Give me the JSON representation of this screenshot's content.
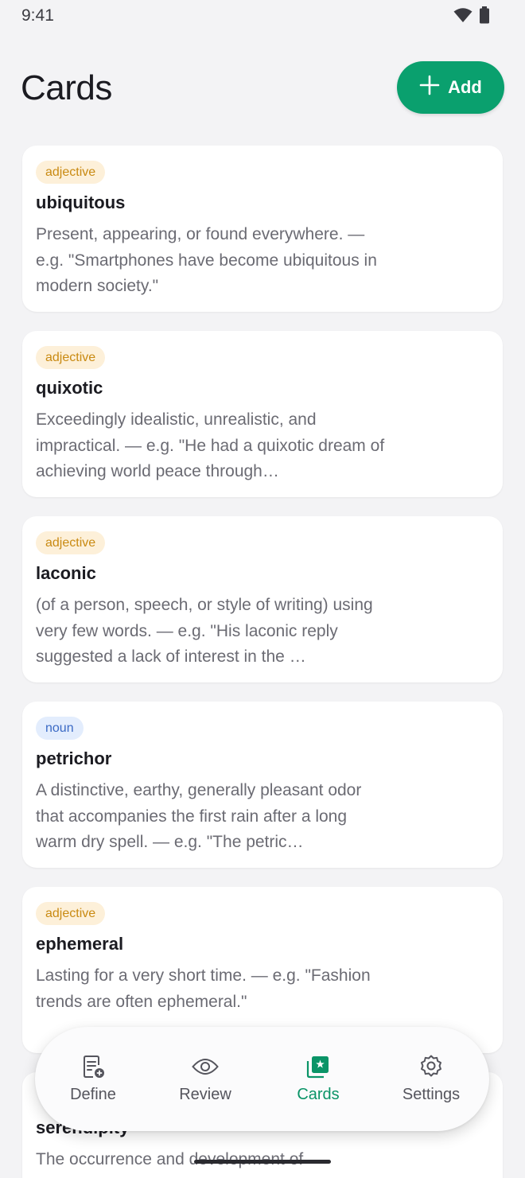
{
  "status_bar": {
    "time": "9:41",
    "icons": [
      "wifi-icon",
      "battery-icon"
    ]
  },
  "header": {
    "title": "Cards",
    "add_label": "Add"
  },
  "cards": [
    {
      "tag": "adjective",
      "word": "ubiquitous",
      "definition": "Present, appearing, or found everywhere. — e.g. \"Smartphones have become ubiquitous in modern society.\""
    },
    {
      "tag": "adjective",
      "word": "quixotic",
      "definition": "Exceedingly idealistic, unrealistic, and impractical. — e.g. \"He had a quixotic dream of achieving world peace through…"
    },
    {
      "tag": "adjective",
      "word": "laconic",
      "definition": "(of a person, speech, or style of writing) using very few words. — e.g. \"His laconic reply suggested a lack of interest in the …"
    },
    {
      "tag": "noun",
      "word": "petrichor",
      "definition": "A distinctive, earthy, generally pleasant odor that accompanies the first rain after a long warm dry spell. — e.g. \"The petric…"
    },
    {
      "tag": "adjective",
      "word": "ephemeral",
      "definition": "Lasting for a very short time. — e.g. \"Fashion trends are often ephemeral.\""
    },
    {
      "tag": "",
      "word": "serendipity",
      "definition": "The occurrence and development of"
    }
  ],
  "nav": {
    "items": [
      {
        "label": "Define",
        "icon": "define-icon"
      },
      {
        "label": "Review",
        "icon": "eye-icon"
      },
      {
        "label": "Cards",
        "icon": "cards-icon",
        "active": true
      },
      {
        "label": "Settings",
        "icon": "gear-icon"
      }
    ]
  },
  "colors": {
    "accent": "#0aa06e",
    "adjective_tag": "#c98a12",
    "noun_tag": "#3b6ac5"
  }
}
